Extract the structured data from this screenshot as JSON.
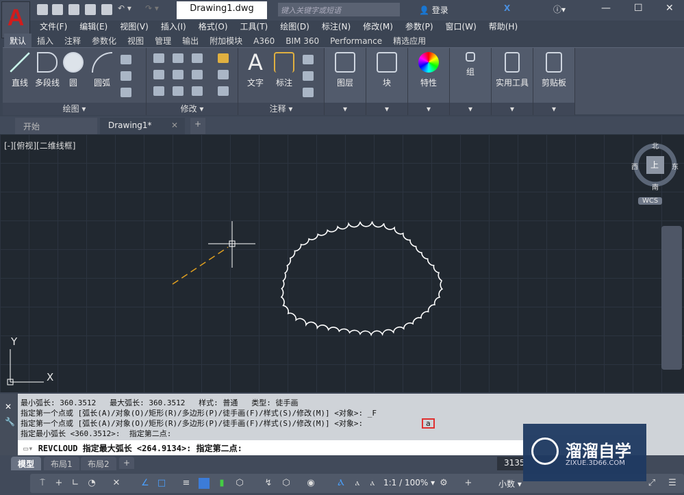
{
  "app": {
    "logo": "A",
    "document_title": "Drawing1.dwg",
    "search_placeholder": "键入关键字或短语",
    "login": "登录"
  },
  "menu": [
    "文件(F)",
    "编辑(E)",
    "视图(V)",
    "插入(I)",
    "格式(O)",
    "工具(T)",
    "绘图(D)",
    "标注(N)",
    "修改(M)",
    "参数(P)",
    "窗口(W)",
    "帮助(H)"
  ],
  "ribbon_tabs": [
    "默认",
    "插入",
    "注释",
    "参数化",
    "视图",
    "管理",
    "输出",
    "附加模块",
    "A360",
    "BIM 360",
    "Performance",
    "精选应用"
  ],
  "panels": {
    "draw": {
      "title": "绘图 ▾",
      "tools": [
        "直线",
        "多段线",
        "圆",
        "圆弧"
      ]
    },
    "modify": {
      "title": "修改 ▾"
    },
    "annotate": {
      "title": "注释 ▾",
      "tools": [
        "文字",
        "标注"
      ]
    },
    "large": [
      "图层",
      "块",
      "特性",
      "组",
      "实用工具",
      "剪贴板"
    ]
  },
  "doc_tabs": [
    "开始",
    "Drawing1*"
  ],
  "viewport_label": "[-][俯视][二维线框]",
  "viewcube": {
    "top": "上",
    "n": "北",
    "s": "南",
    "e": "东",
    "w": "西",
    "wcs": "WCS"
  },
  "ucs": {
    "x": "X",
    "y": "Y"
  },
  "command_history": [
    "最小弧长: 360.3512   最大弧长: 360.3512   样式: 普通   类型: 徒手画",
    "指定第一个点或 [弧长(A)/对象(O)/矩形(R)/多边形(P)/徒手画(F)/样式(S)/修改(M)] <对象>: _F",
    "指定第一个点或 [弧长(A)/对象(O)/矩形(R)/多边形(P)/徒手画(F)/样式(S)/修改(M)] <对象>:",
    "指定最小弧长 <360.3512>:  指定第二点:"
  ],
  "highlighted_input": "a",
  "command_line": "REVCLOUD 指定最大弧长 <264.9134>:  指定第二点:",
  "layout_tabs": [
    "模型",
    "布局1",
    "布局2"
  ],
  "status": {
    "coords": "3135",
    "scale": "1:1 / 100%",
    "units": "小数"
  },
  "watermark": {
    "name": "溜溜自学",
    "url": "ZIXUE.3D66.COM"
  },
  "colors": {
    "cloud": "#ffffff",
    "rubberband": "#e0a020",
    "highlight": "#e03030"
  }
}
